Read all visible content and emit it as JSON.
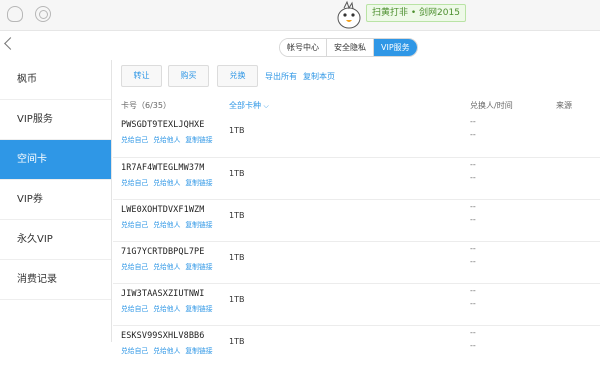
{
  "topbar": {
    "promo": "扫黄打非 • 剑网2015"
  },
  "tabs": [
    "帐号中心",
    "安全隐私",
    "VIP服务"
  ],
  "sidebar": [
    "枫币",
    "VIP服务",
    "空间卡",
    "VIP券",
    "永久VIP",
    "消费记录"
  ],
  "toolbar": {
    "transfer": "转让",
    "buy": "购买",
    "exchange": "兑换",
    "export_all": "导出所有",
    "copy_page": "复制本页"
  },
  "table": {
    "col_card": "卡号（6/35）",
    "col_type": "全部卡种",
    "col_user": "兑换人/时间",
    "col_source": "来源",
    "action_self": "兑给自己",
    "action_other": "兑给他人",
    "action_copy": "复制链接",
    "dash": "--",
    "rows": [
      {
        "code": "PWSGDT9TEXLJQHXE",
        "cap": "1TB"
      },
      {
        "code": "1R7AF4WTEGLMW37M",
        "cap": "1TB"
      },
      {
        "code": "LWE0XOHTDVXF1WZM",
        "cap": "1TB"
      },
      {
        "code": "71G7YCRTDBPQL7PE",
        "cap": "1TB"
      },
      {
        "code": "JIW3TAASXZIUTNWI",
        "cap": "1TB"
      },
      {
        "code": "ESKSV99SXHLV8BB6",
        "cap": "1TB"
      }
    ]
  }
}
